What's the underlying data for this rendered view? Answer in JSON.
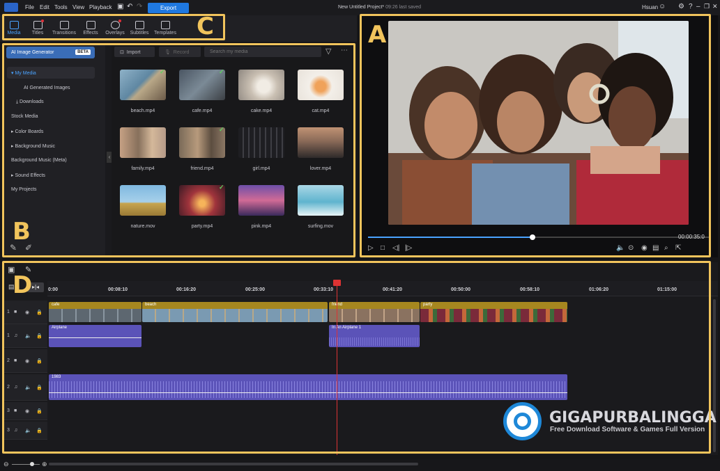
{
  "menu": {
    "file": "File",
    "edit": "Edit",
    "tools": "Tools",
    "view": "View",
    "playback": "Playback",
    "export": "Export",
    "project_title": "New Untitled Project*",
    "saved": "09:26 last saved",
    "user": "Hsuan"
  },
  "rooms": [
    {
      "label": "Media"
    },
    {
      "label": "Titles"
    },
    {
      "label": "Transitions"
    },
    {
      "label": "Effects"
    },
    {
      "label": "Overlays"
    },
    {
      "label": "Subtitles"
    },
    {
      "label": "Templates"
    }
  ],
  "annotations": {
    "a": "A",
    "b": "B",
    "c": "C",
    "d": "D"
  },
  "sidebar": {
    "ai": "AI Image Generator",
    "beta": "BETA",
    "items": [
      "My Media",
      "AI Generated Images",
      "Downloads",
      "Stock Media",
      "Color Boards",
      "Background Music",
      "Background Music (Meta)",
      "Sound Effects",
      "My Projects"
    ]
  },
  "toolbar": {
    "import": "Import",
    "record": "Record",
    "search_placeholder": "Search my media"
  },
  "media": [
    "beach.mp4",
    "cafe.mp4",
    "cake.mp4",
    "cat.mp4",
    "family.mp4",
    "friend.mp4",
    "girl.mp4",
    "lover.mp4",
    "nature.mov",
    "party.mp4",
    "pink.mp4",
    "surfing.mov"
  ],
  "preview": {
    "time": "00:00:35:0",
    "progress": 0.48
  },
  "ruler": [
    "0:00",
    "00:08:10",
    "00:16:20",
    "00:25:00",
    "00:33:10",
    "00:41:20",
    "00:50:00",
    "00:58:10",
    "01:06:20",
    "01:15:00"
  ],
  "tracks": [
    "1",
    "1",
    "2",
    "2",
    "3",
    "3"
  ],
  "clips": {
    "cafe": "cafe",
    "beach": "beach",
    "friend": "friend",
    "party": "party",
    "airplane": "Airplane",
    "inairplane": "In An Airplane 1",
    "a1983": "1983"
  },
  "watermark": {
    "title": "GIGAPURBALINGGA",
    "sub": "Free Download Software & Games Full Version"
  },
  "colors": {
    "accent": "#4aa3ff",
    "annotation": "#f1c45c",
    "export": "#1f78e0"
  }
}
